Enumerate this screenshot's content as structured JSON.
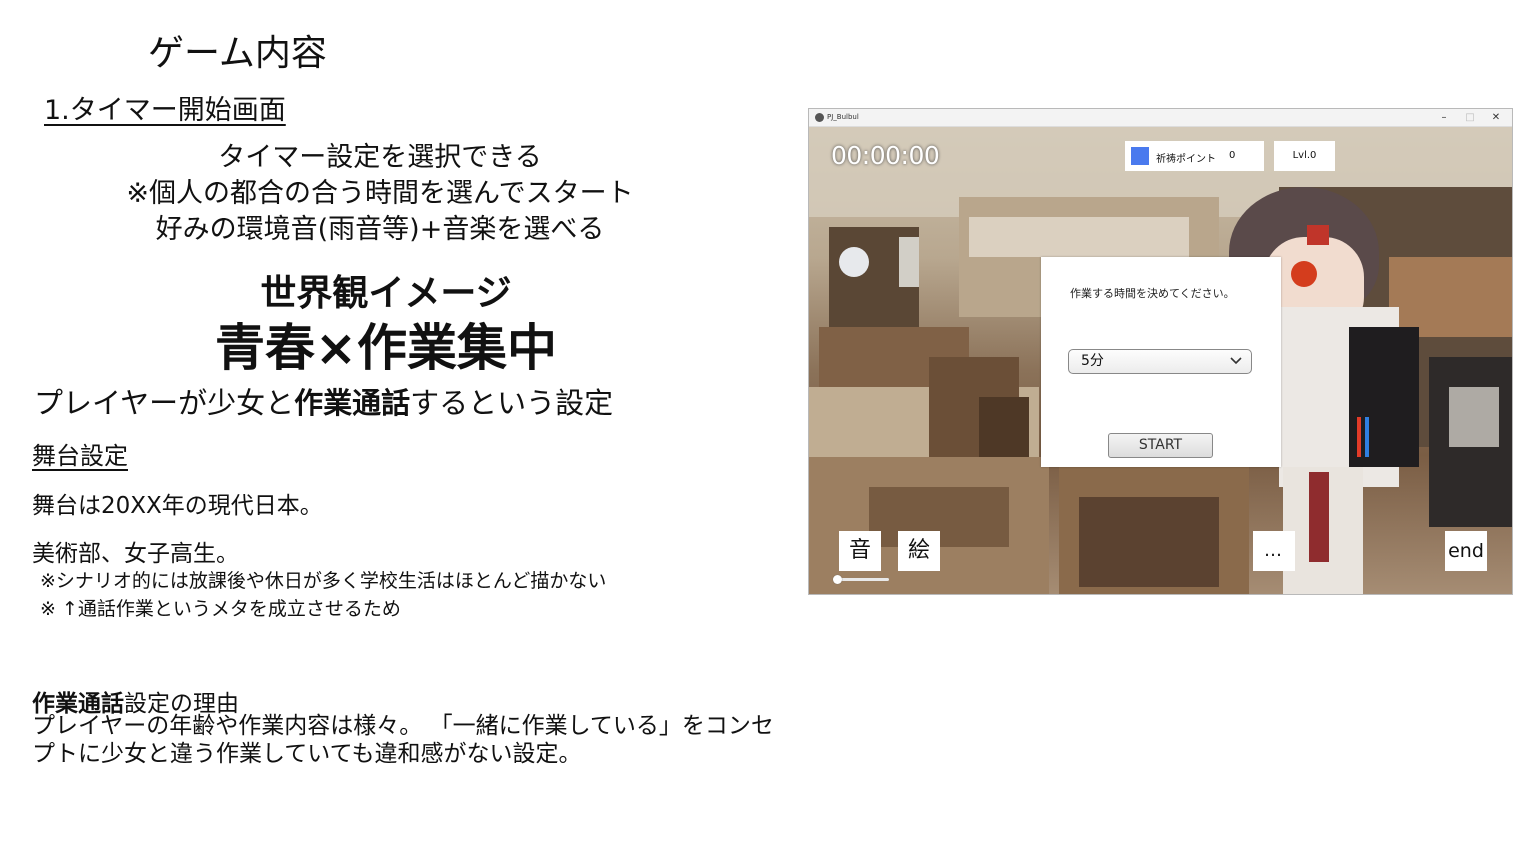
{
  "doc": {
    "title": "ゲーム内容",
    "section_heading": "1.タイマー開始画面",
    "features": [
      "タイマー設定を選択できる",
      "※個人の都合の合う時間を選んでスタート",
      "好みの環境音(雨音等)+音楽を選べる"
    ],
    "concept_label": "世界観イメージ",
    "concept_main": "青春×作業集中",
    "premise_pre": "プレイヤーが少女と",
    "premise_bold": "作業通話",
    "premise_post": "するという設定",
    "stage_heading": "舞台設定",
    "stage_line1": "舞台は20XX年の現代日本。",
    "stage_line2": "美術部、女子高生。",
    "stage_note1": "※シナリオ的には放課後や休日が多く学校生活はほとんど描かない",
    "stage_note2": "※ ↑通話作業というメタを成立させるため",
    "reason_bold": "作業通話",
    "reason_rest": "設定の理由",
    "reason_body": " プレイヤーの年齢や作業内容は様々。 「一緒に作業している」をコンセプトに少女と違う作業していても違和感がない設定。"
  },
  "app": {
    "window_title": "PJ_Bulbul",
    "controls": {
      "minimize": "–",
      "maximize": "□",
      "close": "✕"
    },
    "timer": "00:00:00",
    "points_label": "祈祷ポイント",
    "points_value": "0",
    "level": "Lvl.0",
    "dialog_prompt": "作業する時間を決めてください。",
    "duration_selected": "5分",
    "start_label": "START",
    "sound_label": "音",
    "art_label": "絵",
    "more_label": "…",
    "end_label": "end",
    "volume_level": 0.0,
    "colors": {
      "points_swatch": "#4a7aee"
    }
  }
}
